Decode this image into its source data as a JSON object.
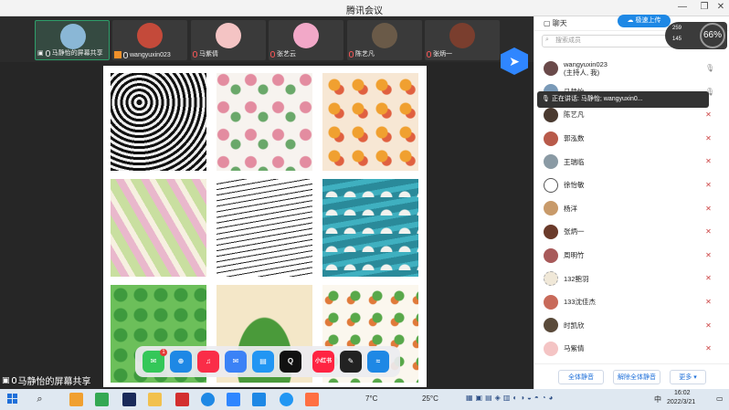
{
  "window": {
    "title": "腾讯会议"
  },
  "strip": {
    "tiles": [
      {
        "label": "马静怡的屏幕共享",
        "color": "#8ab7d6"
      },
      {
        "label": "wangyuxin023",
        "color": "#c44a3a"
      },
      {
        "label": "马紫倩",
        "color": "#f4c4c4"
      },
      {
        "label": "张艺云",
        "color": "#f2a8c8"
      },
      {
        "label": "陈艺凡",
        "color": "#6a5a48"
      },
      {
        "label": "张炳一",
        "color": "#7a3e2e"
      }
    ]
  },
  "dock": {
    "apps": [
      {
        "name": "messages",
        "color": "#34c759",
        "glyph": "✉"
      },
      {
        "name": "safari",
        "color": "#1e88e5",
        "glyph": "⊕"
      },
      {
        "name": "music",
        "color": "#fa2d48",
        "glyph": "♫"
      },
      {
        "name": "mail",
        "color": "#3b82f6",
        "glyph": "✉"
      },
      {
        "name": "files",
        "color": "#2196f3",
        "glyph": "▤"
      },
      {
        "name": "qq",
        "color": "#111111",
        "glyph": "Q"
      },
      {
        "name": "xiaohongshu",
        "color": "#ff2442",
        "glyph": "小红书"
      },
      {
        "name": "procreate",
        "color": "#222222",
        "glyph": "✎"
      },
      {
        "name": "tencent-meeting",
        "color": "#1e88e5",
        "glyph": "≈"
      }
    ],
    "badge": "1"
  },
  "share_label": "马静怡的屏幕共享",
  "panel": {
    "title": "聊天",
    "search_placeholder": "搜索成员",
    "upload_button": "极速上传",
    "speed": {
      "up": "259",
      "down": "145",
      "percent": "66%"
    },
    "tooltip": "正在讲话: 马静怡; wangyuxin0...",
    "members": [
      {
        "name": "wangyuxin023",
        "sub": "(主持人, 我)",
        "color": "#6a4a4a",
        "muted": false
      },
      {
        "name": "马静怡",
        "sub": "",
        "color": "#7a9ab8",
        "muted": false
      },
      {
        "name": "陈艺凡",
        "sub": "",
        "color": "#4a3a30",
        "muted": true
      },
      {
        "name": "郭泓数",
        "sub": "",
        "color": "#b85a4a",
        "muted": true
      },
      {
        "name": "王瑞临",
        "sub": "",
        "color": "#8a9aa4",
        "muted": true
      },
      {
        "name": "徐怡敏",
        "sub": "",
        "color": "#ffffff",
        "muted": true
      },
      {
        "name": "杨洋",
        "sub": "",
        "color": "#c89a6a",
        "muted": true
      },
      {
        "name": "张炳一",
        "sub": "",
        "color": "#6a3a2a",
        "muted": true
      },
      {
        "name": "周明竹",
        "sub": "",
        "color": "#a85a5a",
        "muted": true
      },
      {
        "name": "132鲍羽",
        "sub": "",
        "color": "#f0e8d8",
        "muted": true
      },
      {
        "name": "133沈佳杰",
        "sub": "",
        "color": "#c86a5a",
        "muted": true
      },
      {
        "name": "时凯欣",
        "sub": "",
        "color": "#5a4a3a",
        "muted": true
      },
      {
        "name": "马紫倩",
        "sub": "",
        "color": "#f4c4c4",
        "muted": true
      }
    ],
    "footer": {
      "mute_all": "全体静音",
      "unmute_all": "解除全体静音",
      "more": "更多 ▾"
    }
  },
  "taskbar": {
    "weather1": "7°C",
    "weather2": "25°C",
    "ime": "中",
    "time": "16:02",
    "date": "2022/3/21"
  }
}
